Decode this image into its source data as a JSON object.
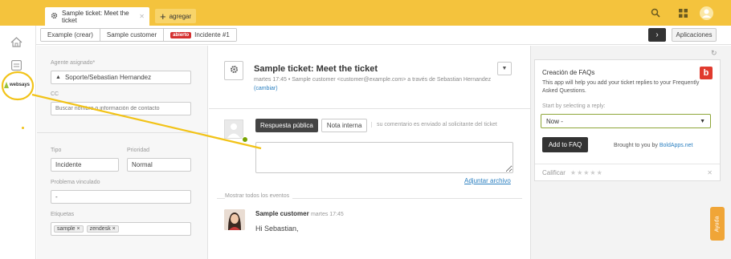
{
  "colors": {
    "topbar": "#f4c33d",
    "badge": "#d42f2f",
    "accent_annotation": "#f2c318",
    "link": "#2a7fc0"
  },
  "tabs": {
    "active_label": "Sample ticket: Meet the ticket",
    "add_label": "agregar"
  },
  "top_icons": [
    "search-icon",
    "apps-grid-icon",
    "user-avatar-icon"
  ],
  "left_rail": {
    "icons": [
      "home-icon",
      "views-icon"
    ],
    "brand": "websays"
  },
  "breadcrumb": {
    "items": [
      "Example (crear)",
      "Sample customer"
    ],
    "status_badge": "abierto",
    "ticket_label": "Incidente #1"
  },
  "toolbar": {
    "apps_label": "Aplicaciones"
  },
  "properties": {
    "assignee_label": "Agente asignado*",
    "assignee_value": "Soporte/Sebastian Hernandez",
    "cc_label": "CC",
    "cc_placeholder": "Buscar nombre o información de contacto",
    "type_label": "Tipo",
    "type_value": "Incidente",
    "priority_label": "Prioridad",
    "priority_value": "Normal",
    "linked_label": "Problema vinculado",
    "linked_value": "-",
    "tags_label": "Etiquetas",
    "tags": [
      "sample",
      "zendesk"
    ]
  },
  "ticket": {
    "subject": "Sample ticket: Meet the ticket",
    "meta_time": "martes 17:45",
    "meta_sep": "•",
    "meta_from": "Sample customer <customer@example.com> a través de Sebastian Hernandez",
    "meta_change": "(cambiar)"
  },
  "composer": {
    "public_label": "Respuesta pública",
    "internal_label": "Nota interna",
    "hint": "su comentario es enviado al solicitante del ticket",
    "attach_label": "Adjuntar archivo"
  },
  "events": {
    "label": "Mostrar todos los eventos",
    "comment_author": "Sample customer",
    "comment_time": "martes 17:45",
    "comment_text": "Hi Sebastian,"
  },
  "app": {
    "title": "Creación de FAQs",
    "logo_letter": "b",
    "description": "This app will help you add your ticket replies to your Frequently Asked Questions.",
    "select_label": "Start by selecting a reply:",
    "select_value": "Now -",
    "add_button": "Add to FAQ",
    "brought_text": "Brought to you by",
    "brought_link": "BoldApps.net",
    "rate_label": "Calificar",
    "rating": 0,
    "rating_max": 5
  },
  "help_button": "Ayuda"
}
